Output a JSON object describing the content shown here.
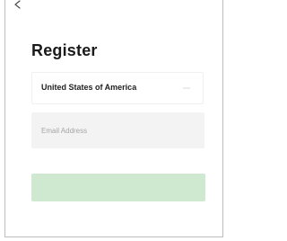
{
  "header": {
    "back_icon": "chevron-left-icon",
    "title": "Register"
  },
  "form": {
    "country": {
      "value": "United States of America",
      "icon": "chevron-down-icon"
    },
    "email": {
      "placeholder": "Email Address",
      "value": ""
    },
    "submit": {
      "label": "",
      "enabled": false
    }
  },
  "colors": {
    "title_text": "#1a1a1a",
    "field_background": "#f3f3f3",
    "placeholder_text": "#a6a6a6",
    "button_disabled": "#cfe9d0",
    "frame_border": "#bdbdbd"
  }
}
